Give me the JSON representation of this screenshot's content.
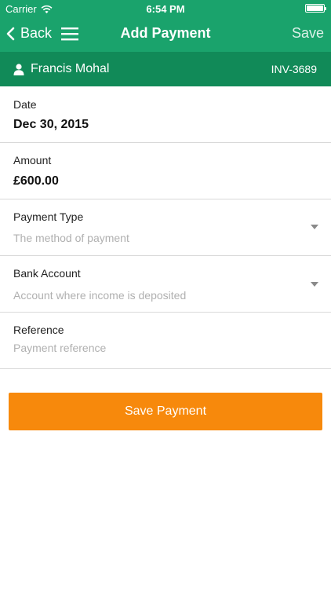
{
  "status_bar": {
    "carrier": "Carrier",
    "time": "6:54 PM"
  },
  "nav": {
    "back_label": "Back",
    "title": "Add Payment",
    "save_label": "Save"
  },
  "client": {
    "name": "Francis Mohal",
    "invoice": "INV-3689"
  },
  "fields": {
    "date": {
      "label": "Date",
      "value": "Dec 30, 2015"
    },
    "amount": {
      "label": "Amount",
      "value": "£600.00"
    },
    "payment_type": {
      "label": "Payment Type",
      "placeholder": "The method of payment"
    },
    "bank_account": {
      "label": "Bank Account",
      "placeholder": "Account where income is deposited"
    },
    "reference": {
      "label": "Reference",
      "placeholder": "Payment reference"
    }
  },
  "save_button": {
    "label": "Save Payment"
  },
  "colors": {
    "header": "#1aa36c",
    "client_bar": "#118a58",
    "button": "#f7890c"
  }
}
